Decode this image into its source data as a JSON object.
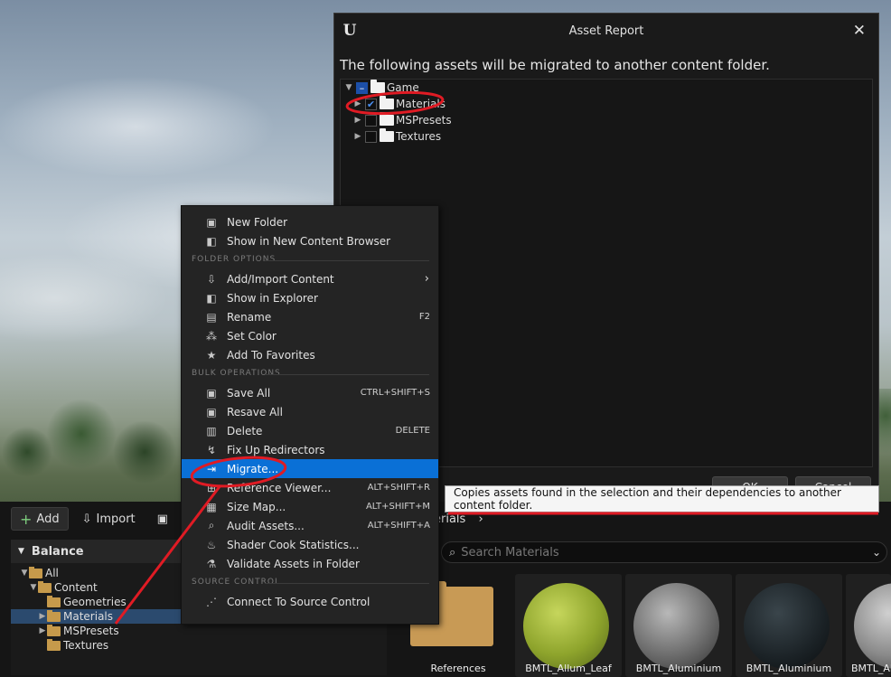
{
  "dialog": {
    "title": "Asset Report",
    "message": "The following assets will be migrated to another content folder.",
    "tree": [
      {
        "label": "Game",
        "state": "partial"
      },
      {
        "label": "Materials",
        "state": "checked"
      },
      {
        "label": "MSPresets",
        "state": "unchecked"
      },
      {
        "label": "Textures",
        "state": "unchecked"
      }
    ],
    "ok_label": "OK",
    "cancel_label": "Cancel"
  },
  "tooltip": "Copies assets found in the selection and their dependencies to another content folder.",
  "menu": {
    "top_items": [
      {
        "label": "New Folder",
        "icon": "new-folder-icon"
      },
      {
        "label": "Show in New Content Browser",
        "icon": "content-browser-icon"
      }
    ],
    "folder_options_header": "FOLDER OPTIONS",
    "folder_options": [
      {
        "label": "Add/Import Content",
        "icon": "import-icon"
      },
      {
        "label": "Show in Explorer",
        "icon": "explorer-icon"
      },
      {
        "label": "Rename",
        "icon": "rename-icon",
        "shortcut": "F2"
      },
      {
        "label": "Set Color",
        "icon": "color-icon"
      },
      {
        "label": "Add To Favorites",
        "icon": "star-icon"
      }
    ],
    "bulk_header": "BULK OPERATIONS",
    "bulk": [
      {
        "label": "Save All",
        "icon": "save-icon",
        "shortcut": "CTRL+SHIFT+S"
      },
      {
        "label": "Resave All",
        "icon": "save-icon"
      },
      {
        "label": "Delete",
        "icon": "trash-icon",
        "shortcut": "DELETE"
      },
      {
        "label": "Fix Up Redirectors",
        "icon": "redirector-icon"
      },
      {
        "label": "Migrate...",
        "icon": "migrate-icon"
      },
      {
        "label": "Reference Viewer...",
        "icon": "reference-icon",
        "shortcut": "ALT+SHIFT+R"
      },
      {
        "label": "Size Map...",
        "icon": "sizemap-icon",
        "shortcut": "ALT+SHIFT+M"
      },
      {
        "label": "Audit Assets...",
        "icon": "audit-icon",
        "shortcut": "ALT+SHIFT+A"
      },
      {
        "label": "Shader Cook Statistics...",
        "icon": "shader-icon"
      },
      {
        "label": "Validate Assets in Folder",
        "icon": "validate-icon"
      }
    ],
    "source_header": "SOURCE CONTROL",
    "source": [
      {
        "label": "Connect To Source Control",
        "icon": "source-control-icon"
      }
    ]
  },
  "browser": {
    "add_label": "Add",
    "import_label": "Import",
    "panel_title": "Balance",
    "tree": [
      {
        "label": "All",
        "indent": 1
      },
      {
        "label": "Content",
        "indent": 2
      },
      {
        "label": "Geometries",
        "indent": 3
      },
      {
        "label": "Materials",
        "indent": 3
      },
      {
        "label": "MSPresets",
        "indent": 3
      },
      {
        "label": "Textures",
        "indent": 3
      }
    ],
    "breadcrumb": "erials",
    "search_placeholder": "Search Materials",
    "tiles": [
      {
        "label": "References",
        "kind": "folder"
      },
      {
        "label": "BMTL_Allum_Leaf",
        "kind": "sphere",
        "color": "#9fb23c"
      },
      {
        "label": "BMTL_Aluminium",
        "kind": "sphere",
        "color": "#7a7a7a"
      },
      {
        "label": "BMTL_Aluminium",
        "kind": "sphere",
        "color": "#1d2327"
      },
      {
        "label": "BMTL_Al",
        "kind": "sphere",
        "color": "#9a9a9a"
      }
    ]
  },
  "colors": {
    "accent": "#0a70d6",
    "annotation": "#e01b24"
  }
}
